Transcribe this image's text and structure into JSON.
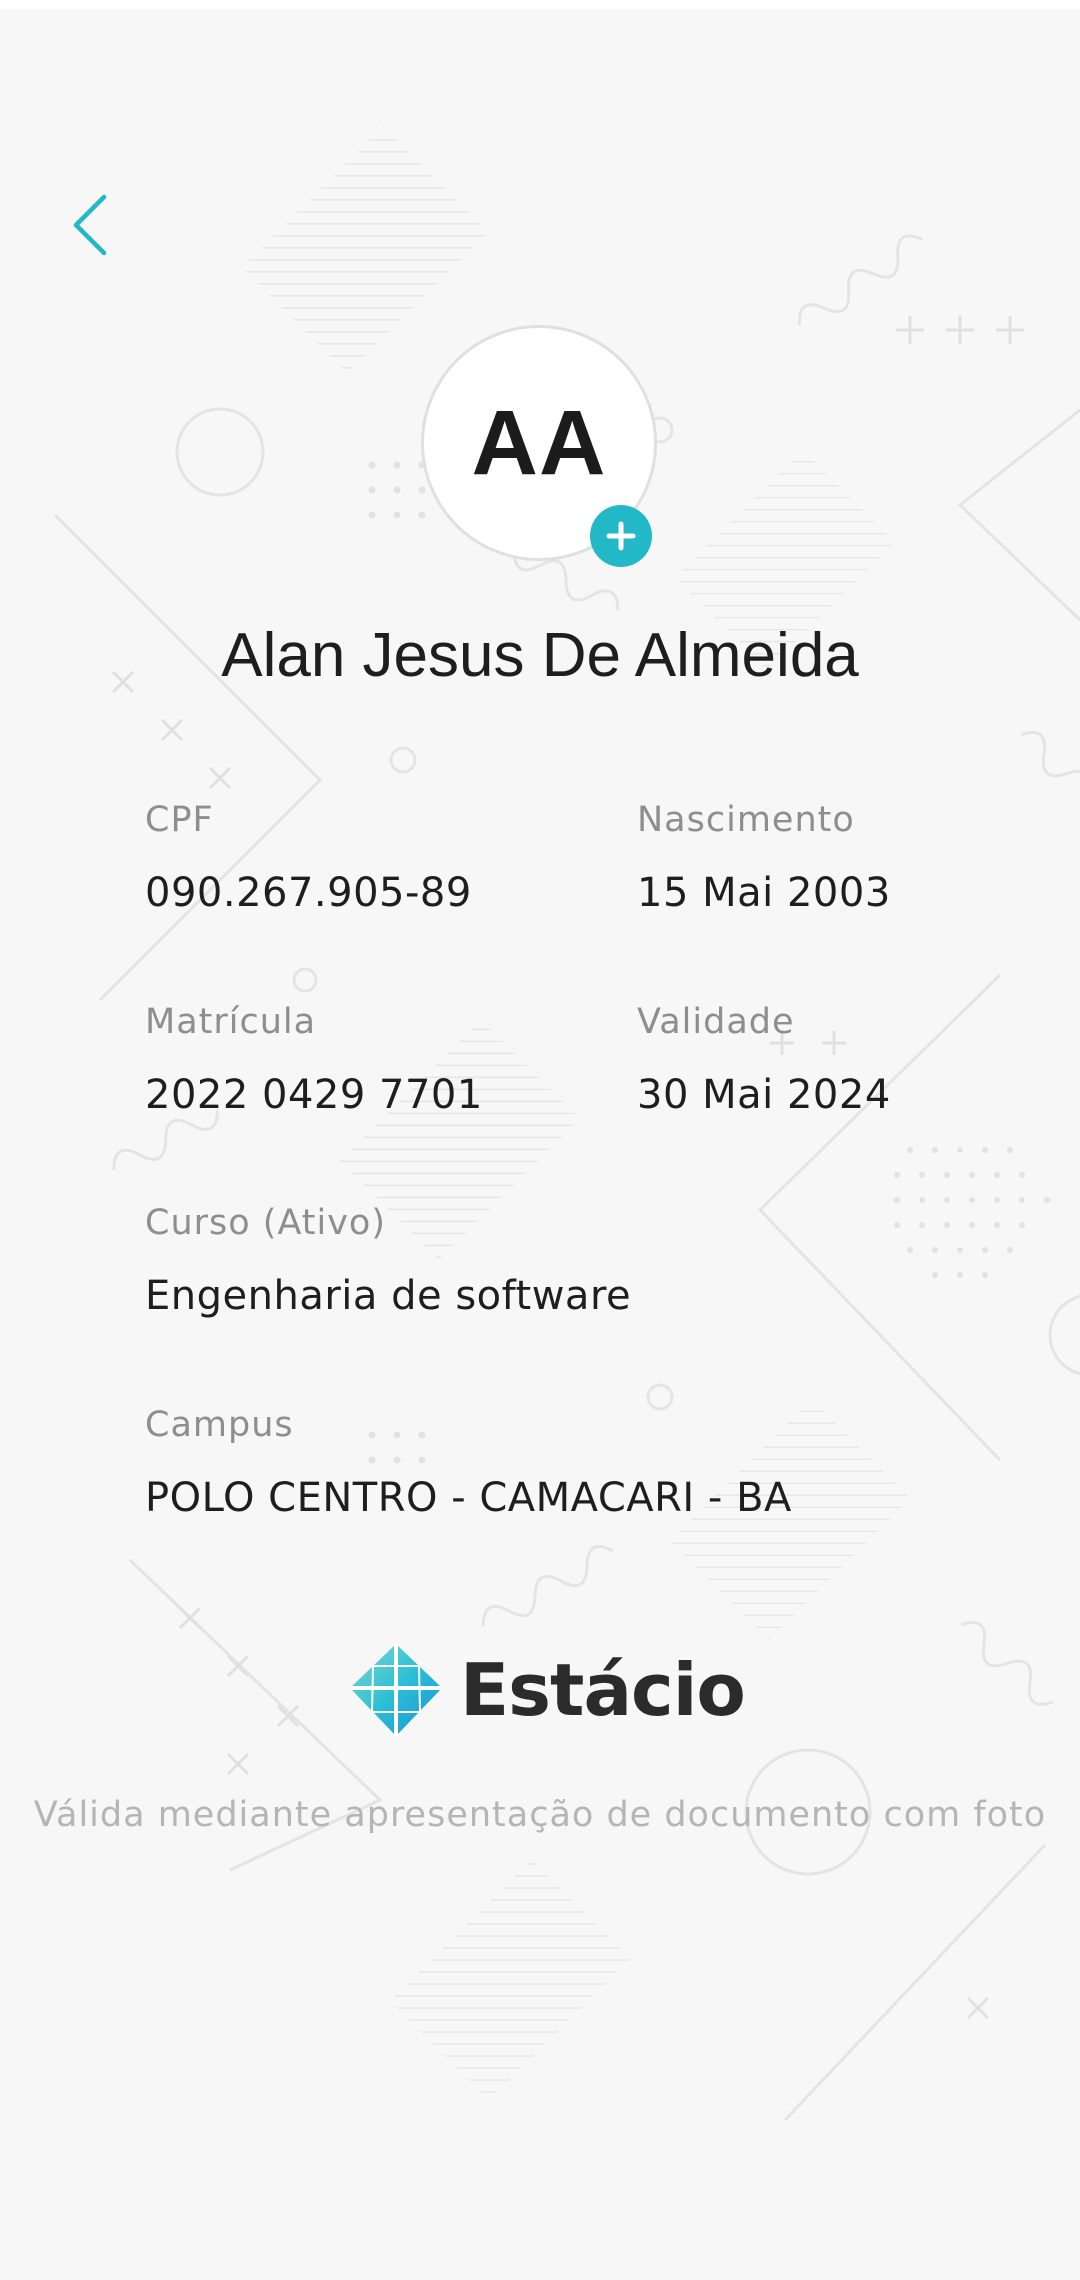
{
  "header": {
    "back_icon": "chevron-left-icon",
    "accent_color": "#22b8c8"
  },
  "profile": {
    "initials": "AA",
    "add_photo_icon": "plus-icon",
    "name": "Alan Jesus De Almeida"
  },
  "fields": {
    "cpf": {
      "label": "CPF",
      "value": "090.267.905-89"
    },
    "birth": {
      "label": "Nascimento",
      "value": "15 Mai 2003"
    },
    "registration": {
      "label": "Matrícula",
      "value": "2022 0429 7701"
    },
    "validity": {
      "label": "Validade",
      "value": "30 Mai 2024"
    },
    "course": {
      "label": "Curso (Ativo)",
      "value": "Engenharia de software"
    },
    "campus": {
      "label": "Campus",
      "value": "POLO CENTRO - CAMACARI - BA"
    }
  },
  "brand": {
    "logo_text": "Estácio"
  },
  "footer": {
    "note": "Válida mediante apresentação de documento com foto"
  }
}
